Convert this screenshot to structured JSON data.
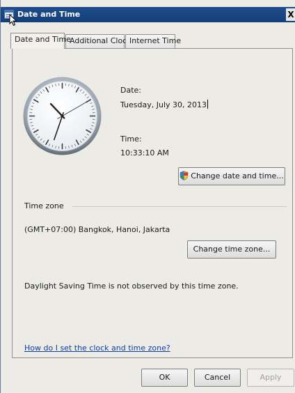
{
  "window": {
    "title": "Date and Time",
    "close_glyph": "X"
  },
  "tabs": [
    {
      "label": "Date and Time",
      "active": true
    },
    {
      "label": "Additional Clocks",
      "active": false
    },
    {
      "label": "Internet Time",
      "active": false
    }
  ],
  "date": {
    "label": "Date:",
    "value": "Tuesday, July 30, 2013"
  },
  "time": {
    "label": "Time:",
    "value": "10:33:10 AM"
  },
  "buttons": {
    "change_date_time": "Change date and time...",
    "change_time_zone": "Change time zone...",
    "ok": "OK",
    "cancel": "Cancel",
    "apply": "Apply"
  },
  "timezone": {
    "group_label": "Time zone",
    "value": "(GMT+07:00) Bangkok, Hanoi, Jakarta",
    "dst_note": "Daylight Saving Time is not observed by this time zone."
  },
  "help_link": "How do I set the clock and time zone?",
  "icons": {
    "app": "date-time-icon",
    "shield": "uac-shield-icon",
    "cursor": "mouse-pointer-icon"
  }
}
